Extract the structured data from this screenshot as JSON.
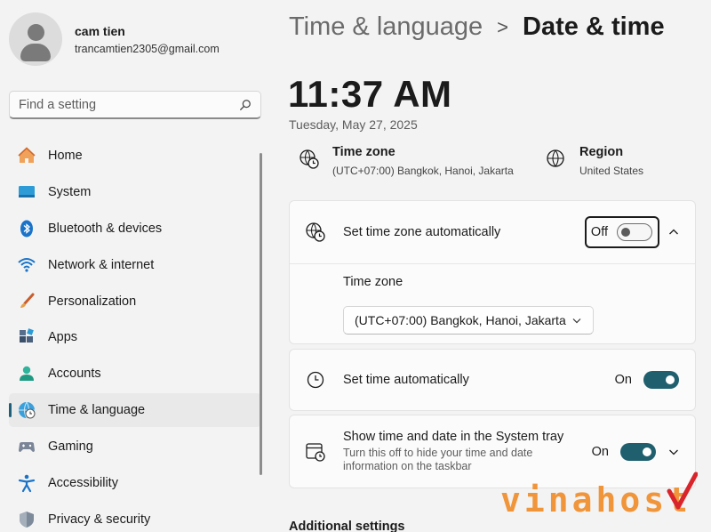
{
  "user": {
    "name": "cam tien",
    "email": "trancamtien2305@gmail.com"
  },
  "search": {
    "placeholder": "Find a setting",
    "icon": "search-icon"
  },
  "nav": {
    "items": [
      {
        "label": "Home",
        "icon": "home-icon",
        "active": false
      },
      {
        "label": "System",
        "icon": "system-icon",
        "active": false
      },
      {
        "label": "Bluetooth & devices",
        "icon": "bluetooth-icon",
        "active": false
      },
      {
        "label": "Network & internet",
        "icon": "wifi-icon",
        "active": false
      },
      {
        "label": "Personalization",
        "icon": "brush-icon",
        "active": false
      },
      {
        "label": "Apps",
        "icon": "apps-icon",
        "active": false
      },
      {
        "label": "Accounts",
        "icon": "accounts-icon",
        "active": false
      },
      {
        "label": "Time & language",
        "icon": "globe-clock-icon",
        "active": true
      },
      {
        "label": "Gaming",
        "icon": "gamepad-icon",
        "active": false
      },
      {
        "label": "Accessibility",
        "icon": "accessibility-icon",
        "active": false
      },
      {
        "label": "Privacy & security",
        "icon": "shield-icon",
        "active": false
      }
    ]
  },
  "breadcrumb": {
    "parent": "Time & language",
    "separator": ">",
    "current": "Date & time"
  },
  "clock": {
    "time": "11:37 AM",
    "date": "Tuesday, May 27, 2025"
  },
  "info": {
    "timezone": {
      "title": "Time zone",
      "value": "(UTC+07:00) Bangkok, Hanoi, Jakarta",
      "icon": "globe-clock-icon"
    },
    "region": {
      "title": "Region",
      "value": "United States",
      "icon": "globe-icon"
    }
  },
  "settings": {
    "auto_timezone": {
      "label": "Set time zone automatically",
      "state": "Off",
      "icon": "globe-clock-icon"
    },
    "timezone_select": {
      "label": "Time zone",
      "value": "(UTC+07:00) Bangkok, Hanoi, Jakarta"
    },
    "auto_time": {
      "label": "Set time automatically",
      "state": "On",
      "icon": "clock-icon"
    },
    "tray": {
      "label": "Show time and date in the System tray",
      "sub": "Turn this off to hide your time and date information on the taskbar",
      "state": "On",
      "icon": "calendar-clock-icon"
    }
  },
  "additional": {
    "title": "Additional settings"
  },
  "watermark": {
    "text": "vinahost"
  },
  "colors": {
    "accent": "#1f5f6e",
    "watermark": "#f08b26"
  }
}
